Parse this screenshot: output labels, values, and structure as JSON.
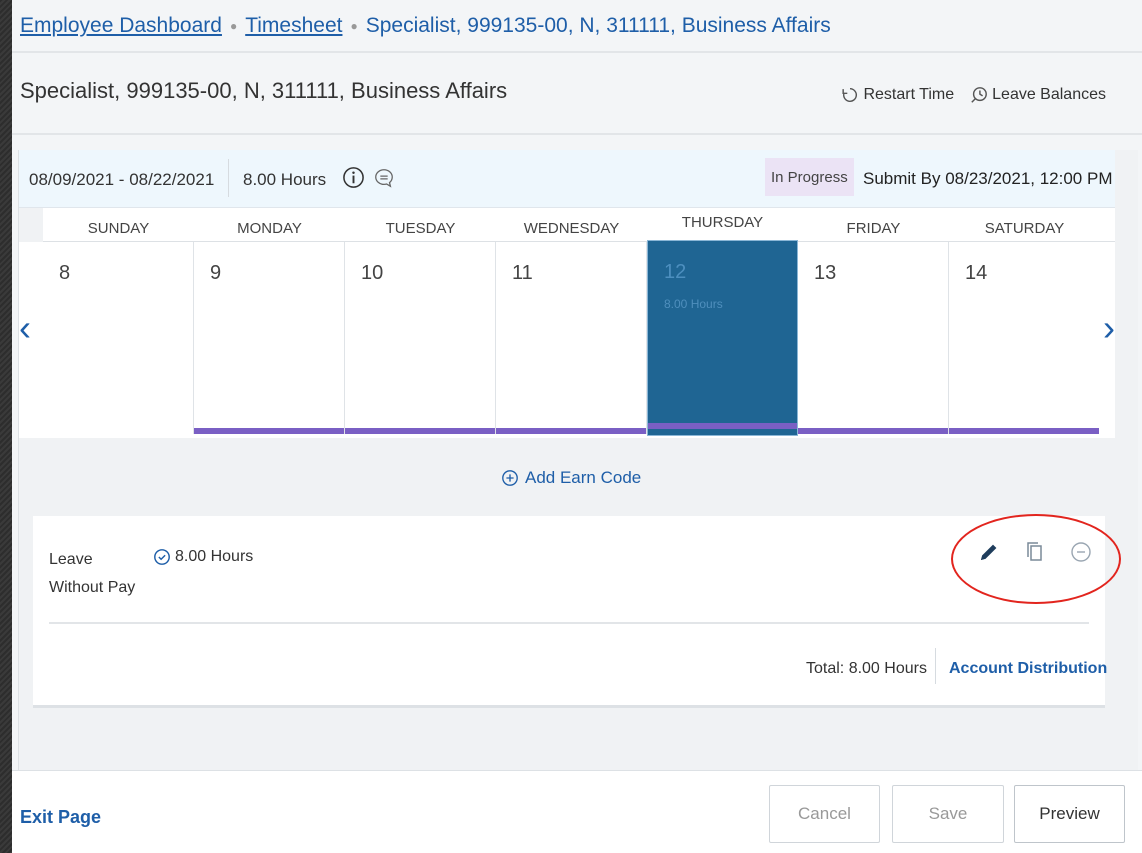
{
  "breadcrumb": {
    "items": [
      "Employee Dashboard",
      "Timesheet"
    ],
    "current": "Specialist, 999135-00, N, 311111, Business Affairs"
  },
  "page_title": "Specialist, 999135-00, N, 311111, Business Affairs",
  "header_actions": {
    "restart": "Restart Time",
    "leave_balances": "Leave Balances"
  },
  "period": {
    "range": "08/09/2021 - 08/22/2021",
    "hours": "8.00 Hours",
    "status": "In Progress",
    "submit_by": "Submit By 08/23/2021, 12:00 PM"
  },
  "calendar": {
    "days": [
      {
        "name": "SUNDAY",
        "num": "8"
      },
      {
        "name": "MONDAY",
        "num": "9"
      },
      {
        "name": "TUESDAY",
        "num": "10"
      },
      {
        "name": "WEDNESDAY",
        "num": "11"
      },
      {
        "name": "THURSDAY",
        "num": "12",
        "hours": "8.00 Hours"
      },
      {
        "name": "FRIDAY",
        "num": "13"
      },
      {
        "name": "SATURDAY",
        "num": "14"
      }
    ],
    "prev": "‹",
    "next": "›"
  },
  "add_earn_code": "Add Earn Code",
  "earn_entry": {
    "name": "Leave Without Pay",
    "hours": "8.00 Hours",
    "total": "Total: 8.00 Hours",
    "account_distribution": "Account Distribution",
    "icons": [
      "pencil-icon",
      "copy-icon",
      "minus-circle-icon"
    ]
  },
  "footer": {
    "exit": "Exit Page",
    "cancel": "Cancel",
    "save": "Save",
    "preview": "Preview"
  },
  "colors": {
    "link": "#1e5ea8",
    "selected_day": "#1f6593",
    "day_bar": "#7a5fc4",
    "status_badge": "#ebe3f5",
    "highlight": "#e2251e"
  }
}
